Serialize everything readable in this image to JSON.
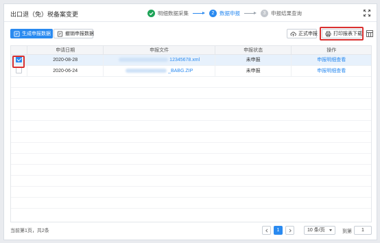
{
  "header": {
    "title": "出口退（免）税备案变更",
    "steps": [
      {
        "label": "明细数据采集",
        "state": "done",
        "index": "1"
      },
      {
        "label": "数据申报",
        "state": "active",
        "index": "2"
      },
      {
        "label": "申报结果查询",
        "state": "todo",
        "index": "3"
      }
    ]
  },
  "toolbar": {
    "generate_label": "生成申报数据",
    "withdraw_label": "撤销申报数据",
    "formal_label": "正式申报",
    "print_label": "打印报表下载"
  },
  "table": {
    "columns": [
      "申请日期",
      "申报文件",
      "申报状态",
      "操作"
    ],
    "rows": [
      {
        "date": "2020-08-28",
        "file_suffix": "12345678.xml",
        "status": "未申报",
        "action": "申报明细查看",
        "checked": true
      },
      {
        "date": "2020-06-24",
        "file_suffix": "_BABG.ZIP",
        "status": "未申报",
        "action": "申报明细查看",
        "checked": false
      }
    ]
  },
  "footer": {
    "total_text": "当前第1页，共2条",
    "current_page": "1",
    "page_size": "10 条/页",
    "goto_label": "到第",
    "goto_value": "1"
  },
  "colors": {
    "primary": "#2a8af0",
    "success": "#1da357",
    "highlight": "#d9302f"
  }
}
